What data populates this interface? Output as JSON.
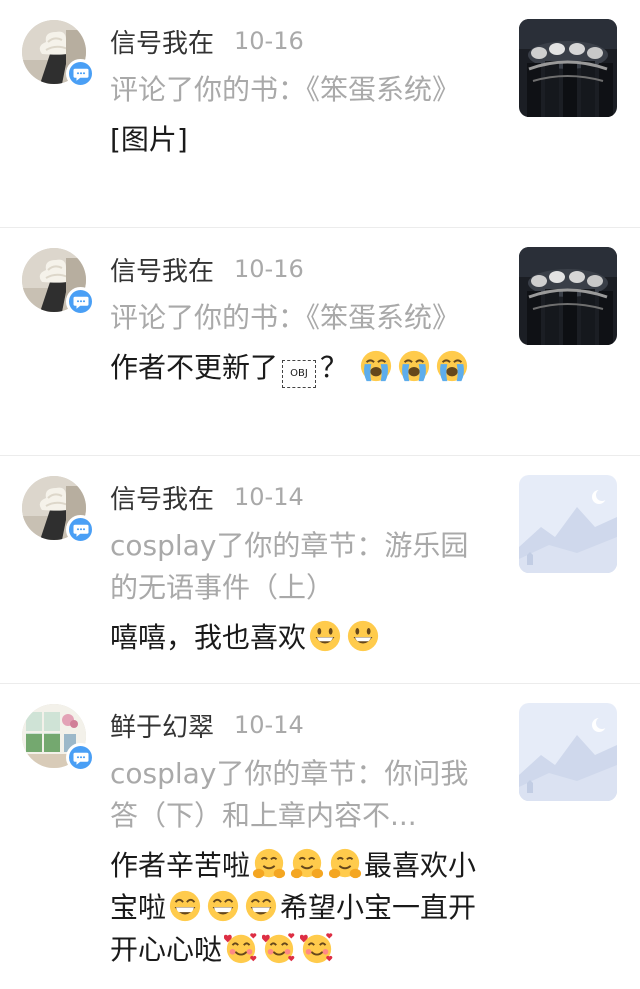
{
  "notifications": [
    {
      "name": "信号我在",
      "date": "10-16",
      "subject": "评论了你的书：《笨蛋系统》",
      "message": "[图片]",
      "avatar": "ice-cream-avatar",
      "thumbnail": "dark-group-photo"
    },
    {
      "name": "信号我在",
      "date": "10-16",
      "subject": "评论了你的书：《笨蛋系统》",
      "message": "作者不更新了",
      "message_tail": "？",
      "object_placeholder": "OBJ",
      "message_emojis": [
        "loudly-crying-face",
        "loudly-crying-face",
        "loudly-crying-face"
      ],
      "avatar": "ice-cream-avatar",
      "thumbnail": "dark-group-photo"
    },
    {
      "name": "信号我在",
      "date": "10-14",
      "subject": "cosplay了你的章节：游乐园的无语事件（上）",
      "message": "嘻嘻，我也喜欢",
      "message_emojis": [
        "grinning-face",
        "grinning-face"
      ],
      "avatar": "ice-cream-avatar",
      "thumbnail": "placeholder-landscape"
    },
    {
      "name": "鲜于幻翠",
      "date": "10-14",
      "subject": "cosplay了你的章节：你问我答（下）和上章内容不...",
      "message_part1": "作者辛苦啦",
      "message_part2": "最喜欢小宝啦",
      "message_part3": "希望小宝一直开开心心哒",
      "emojis_1": [
        "hugging-face",
        "hugging-face",
        "hugging-face"
      ],
      "emojis_2": [
        "beaming-face",
        "beaming-face",
        "beaming-face"
      ],
      "emojis_3": [
        "smiling-face-with-hearts",
        "smiling-face-with-hearts",
        "smiling-face-with-hearts"
      ],
      "avatar": "window-scene-avatar",
      "thumbnail": "placeholder-landscape"
    }
  ],
  "colors": {
    "badge": "#4a9ff5",
    "secondary_text": "#a9a9a9",
    "divider": "#ececec"
  }
}
